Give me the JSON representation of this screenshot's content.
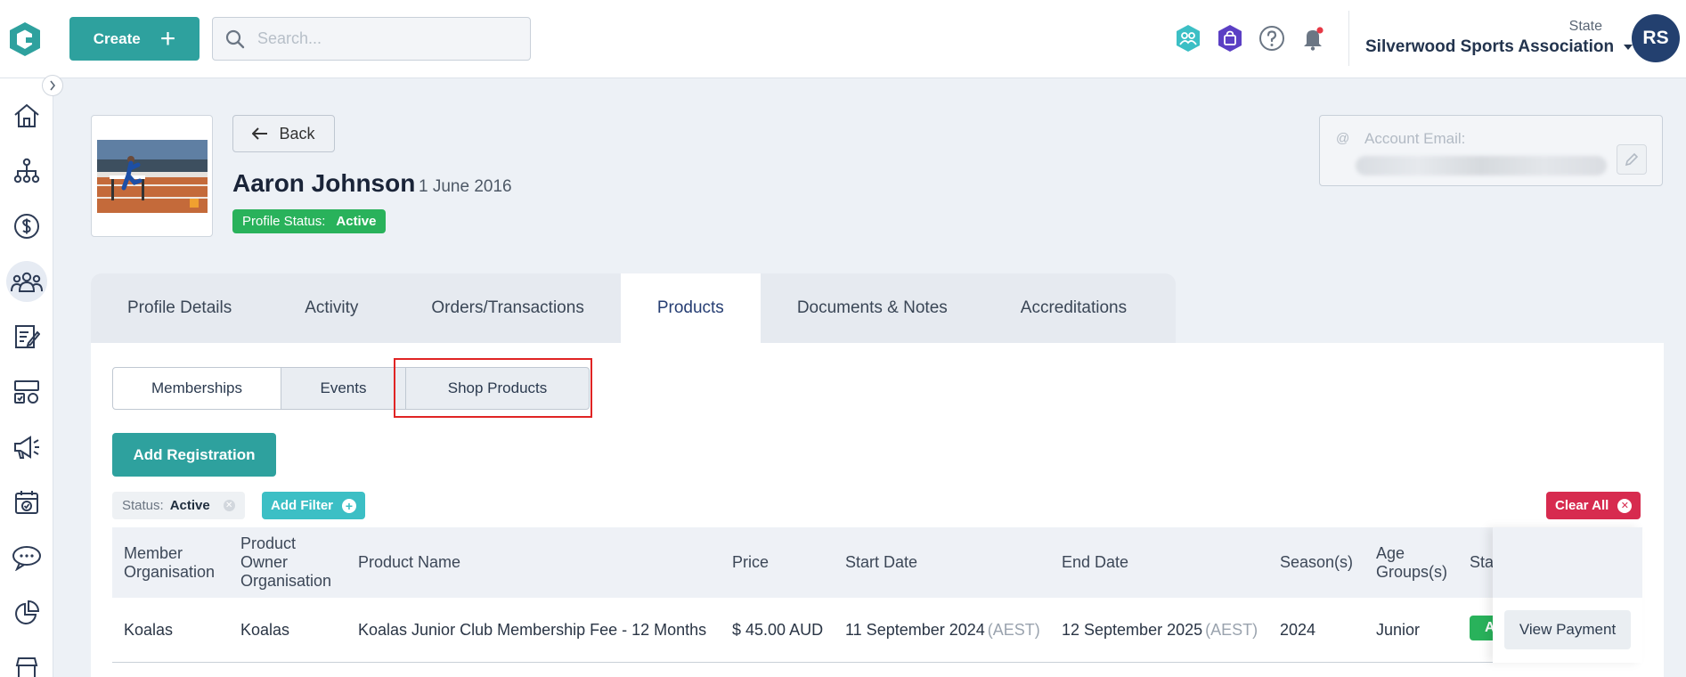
{
  "topbar": {
    "create_label": "Create",
    "search_placeholder": "Search...",
    "state_label": "State",
    "organisation": "Silverwood Sports Association",
    "avatar_initials": "RS"
  },
  "colors": {
    "brand_teal": "#2ea19e",
    "navy": "#23406f",
    "active_green": "#29b25b",
    "danger_red": "#d72b4f",
    "highlight_red": "#e02424"
  },
  "icons": {
    "top": [
      "team-icon",
      "shield-bag-icon",
      "help-icon",
      "bell-icon"
    ],
    "sidebar": [
      "home-icon",
      "org-chart-icon",
      "dollar-icon",
      "users-icon",
      "form-icon",
      "competition-icon",
      "megaphone-icon",
      "calendar-icon",
      "chat-icon",
      "pie-chart-icon",
      "shop-icon"
    ]
  },
  "profile": {
    "back_label": "Back",
    "name": "Aaron Johnson",
    "dob": "1 June 2016",
    "status_label": "Profile Status:",
    "status_value": "Active",
    "email_label": "Account Email:",
    "email_at": "@"
  },
  "tabs": [
    {
      "label": "Profile Details"
    },
    {
      "label": "Activity"
    },
    {
      "label": "Orders/Transactions"
    },
    {
      "label": "Products",
      "active": true
    },
    {
      "label": "Documents & Notes"
    },
    {
      "label": "Accreditations"
    }
  ],
  "subtabs": [
    {
      "label": "Memberships",
      "active": true
    },
    {
      "label": "Events"
    },
    {
      "label": "Shop Products"
    }
  ],
  "actions": {
    "add_registration": "Add Registration",
    "add_filter": "Add Filter",
    "clear_all": "Clear All"
  },
  "filter_chip": {
    "label": "Status:",
    "value": "Active"
  },
  "table": {
    "columns": [
      "Member Organisation",
      "Product Owner Organisation",
      "Product Name",
      "Price",
      "Start Date",
      "End Date",
      "Season(s)",
      "Age Groups(s)",
      "Sta"
    ],
    "rows": [
      {
        "member_org": "Koalas",
        "owner_org": "Koalas",
        "product": "Koalas Junior Club Membership Fee - 12 Months",
        "price": "$ 45.00 AUD",
        "start": "11 September 2024",
        "start_tz": "(AEST)",
        "end": "12 September 2025",
        "end_tz": "(AEST)",
        "season": "2024",
        "age_group": "Junior",
        "status_fragment": "A",
        "action": "View Payment"
      }
    ]
  }
}
